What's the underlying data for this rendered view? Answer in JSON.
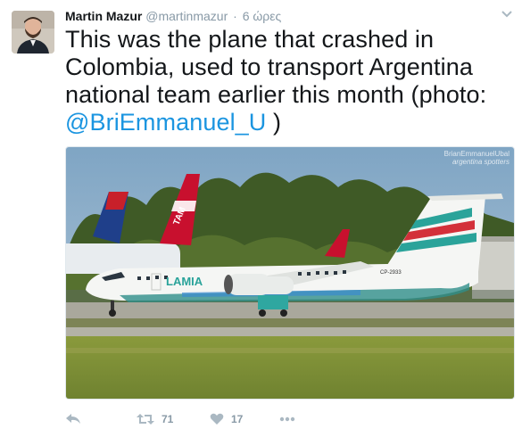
{
  "tweet": {
    "author": {
      "display_name": "Martin Mazur",
      "handle": "@martinmazur"
    },
    "separator": "·",
    "timestamp": "6 ώρες",
    "text_part1": "This was the plane that crashed in Colombia, used to transport Argentina national team earlier this month (photo: ",
    "mention": "@BriEmmanuel_U",
    "text_part2": " )",
    "media": {
      "watermark_line1": "BrianEmmanuelUbal",
      "watermark_line2": "argentina spotters",
      "aircraft_registration": "CP-2933",
      "aircraft_livery": "LAMIA",
      "tail_logo": "TAM"
    },
    "actions": {
      "reply_icon": "reply-icon",
      "retweet_icon": "retweet-icon",
      "retweet_count": "71",
      "like_icon": "heart-icon",
      "like_count": "17",
      "more_icon": "more-icon"
    },
    "colors": {
      "link": "#1b95e0",
      "meta": "#8899a6",
      "icon": "#aab8c2",
      "text": "#14171a"
    }
  }
}
